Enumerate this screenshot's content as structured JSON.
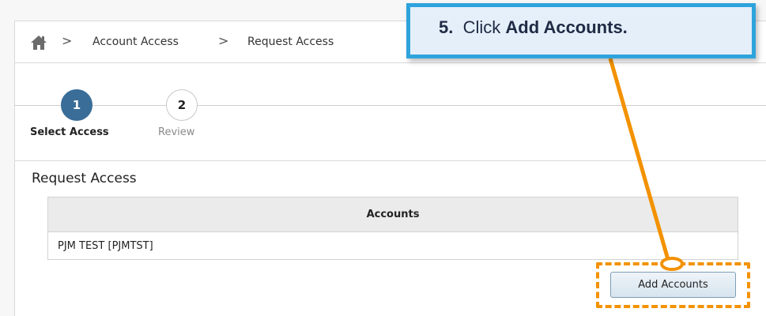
{
  "breadcrumb": {
    "items": [
      "Account Access",
      "Request Access"
    ],
    "separator": ">"
  },
  "steps": [
    {
      "number": "1",
      "label": "Select Access",
      "state": "active"
    },
    {
      "number": "2",
      "label": "Review",
      "state": "inactive"
    }
  ],
  "section": {
    "title": "Request Access"
  },
  "table": {
    "header": "Accounts",
    "rows": [
      "PJM TEST [PJMTST]"
    ]
  },
  "actions": {
    "add_accounts_label": "Add Accounts"
  },
  "callout": {
    "step": "5.",
    "text": "Click",
    "emphasis": "Add Accounts."
  },
  "colors": {
    "accent": "#3a6d98",
    "highlight": "#f39200",
    "callout_border": "#2ea3dc"
  }
}
